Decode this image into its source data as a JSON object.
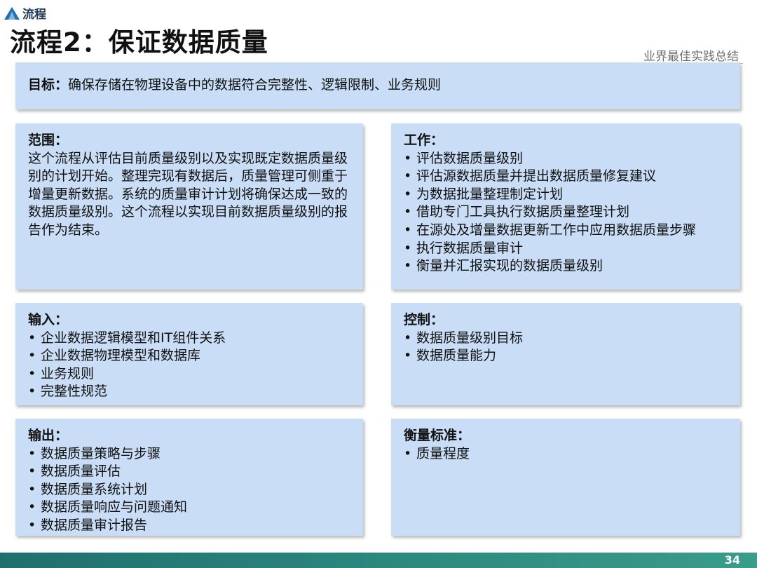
{
  "header": {
    "section_label": "流程",
    "title": "流程2：保证数据质量",
    "tagline": "业界最佳实践总结"
  },
  "goal": {
    "label": "目标：",
    "text": "确保存储在物理设备中的数据符合完整性、逻辑限制、业务规则"
  },
  "scope": {
    "title": "范围：",
    "text": "这个流程从评估目前质量级别以及实现既定数据质量级别的计划开始。整理完现有数据后，质量管理可侧重于增量更新数据。系统的质量审计计划将确保达成一致的数据质量级别。这个流程以实现目前数据质量级别的报告作为结束。"
  },
  "work": {
    "title": "工作：",
    "items": [
      "评估数据质量级别",
      "评估源数据质量并提出数据质量修复建议",
      "为数据批量整理制定计划",
      "借助专门工具执行数据质量整理计划",
      "在源处及增量数据更新工作中应用数据质量步骤",
      "执行数据质量审计",
      "衡量并汇报实现的数据质量级别"
    ]
  },
  "input": {
    "title": "输入：",
    "items": [
      "企业数据逻辑模型和IT组件关系",
      "企业数据物理模型和数据库",
      "业务规则",
      "完整性规范"
    ]
  },
  "control": {
    "title": "控制：",
    "items": [
      "数据质量级别目标",
      "数据质量能力"
    ]
  },
  "output": {
    "title": "输出：",
    "items": [
      "数据质量策略与步骤",
      "数据质量评估",
      "数据质量系统计划",
      "数据质量响应与问题通知",
      "数据质量审计报告"
    ]
  },
  "metric": {
    "title": "衡量标准：",
    "items": [
      "质量程度"
    ]
  },
  "footer": {
    "page_number": "34"
  },
  "colors": {
    "box_fill": "#c9ddf6",
    "footer": "#2c8a7e",
    "logo": "#1f6fb2"
  }
}
